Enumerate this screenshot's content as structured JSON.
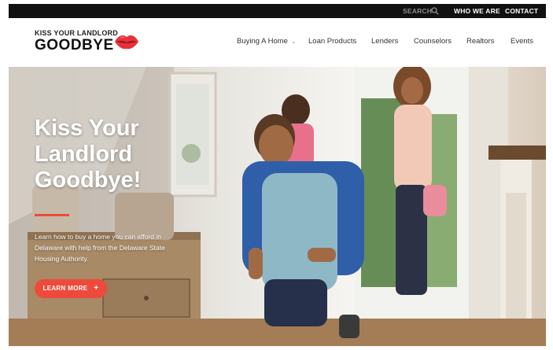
{
  "topbar": {
    "search_label": "SEARCH",
    "who_we_are": "WHO WE ARE",
    "contact": "CONTACT"
  },
  "logo": {
    "line1": "KISS YOUR LANDLORD",
    "line2": "GOODBYE",
    "icon": "lips-icon"
  },
  "nav": {
    "items": [
      {
        "label": "Buying A Home",
        "has_dropdown": true
      },
      {
        "label": "Loan Products"
      },
      {
        "label": "Lenders"
      },
      {
        "label": "Counselors"
      },
      {
        "label": "Realtors"
      },
      {
        "label": "Events"
      }
    ]
  },
  "hero": {
    "title": "Kiss Your Landlord Goodbye!",
    "text": "Learn how to buy a home you can afford in Delaware with help from the Delaware State Housing Authority.",
    "button_label": "LEARN MORE",
    "button_icon": "plus-icon"
  },
  "colors": {
    "accent": "#ee4a3b",
    "topbar_bg": "#111111",
    "text_dark": "#333333"
  }
}
